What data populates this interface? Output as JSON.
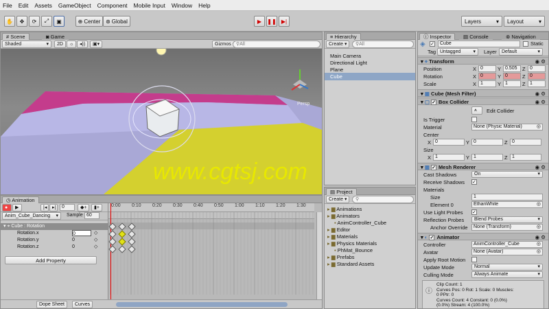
{
  "menu": [
    "File",
    "Edit",
    "Assets",
    "GameObject",
    "Component",
    "Mobile Input",
    "Window",
    "Help"
  ],
  "toolbar": {
    "pivot": "Center",
    "space": "Global",
    "layers": "Layers",
    "layout": "Layout"
  },
  "scene": {
    "tab_scene": "Scene",
    "tab_game": "Game",
    "shading": "Shaded",
    "mode_2d": "2D",
    "gizmos": "Gizmos",
    "search_placeholder": "All",
    "persp": "Persp",
    "watermark": "www.cgtsj.com",
    "colors": {
      "magenta": "#c43c8c",
      "yellow": "#d6d226",
      "lavender": "#b8b7e6",
      "watermark": "#e8e800"
    }
  },
  "hierarchy": {
    "tab": "Hierarchy",
    "create": "Create",
    "search_placeholder": "All",
    "items": [
      "Main Camera",
      "Directional Light",
      "Plane",
      "Cube"
    ],
    "selected": "Cube"
  },
  "project": {
    "tab": "Project",
    "create": "Create",
    "items": [
      {
        "label": "Animations",
        "level": 0
      },
      {
        "label": "Animators",
        "level": 0
      },
      {
        "label": "AnimController_Cube",
        "level": 1
      },
      {
        "label": "Editor",
        "level": 0
      },
      {
        "label": "Materials",
        "level": 0
      },
      {
        "label": "Physics Materials",
        "level": 0
      },
      {
        "label": "PhMat_Bounce",
        "level": 1
      },
      {
        "label": "Prefabs",
        "level": 0
      },
      {
        "label": "Standard Assets",
        "level": 0
      }
    ]
  },
  "animation": {
    "tab": "Animation",
    "frame": "0",
    "clip": "Anim_Cube_Dancing",
    "sample_label": "Sample",
    "sample": "60",
    "root": "Cube : Rotation",
    "props": [
      "Rotation.x",
      "Rotation.y",
      "Rotation.z"
    ],
    "values": [
      "0",
      "0",
      "0"
    ],
    "add_property": "Add Property",
    "ticks": [
      "0:00",
      "0:10",
      "0:20",
      "0:30",
      "0:40",
      "0:50",
      "1:00",
      "1:10",
      "1:20",
      "1:30"
    ],
    "dope_sheet": "Dope Sheet",
    "curves": "Curves"
  },
  "inspector": {
    "tab": "Inspector",
    "tab_console": "Console",
    "tab_nav": "Navigation",
    "name": "Cube",
    "static": "Static",
    "tag_label": "Tag",
    "tag": "Untagged",
    "layer_label": "Layer",
    "layer": "Default",
    "transform": "Transform",
    "position": {
      "label": "Position",
      "x": "0",
      "y": "0.505",
      "z": "0"
    },
    "rotation": {
      "label": "Rotation",
      "x": "0",
      "y": "0",
      "z": "0"
    },
    "scale": {
      "label": "Scale",
      "x": "1",
      "y": "1",
      "z": "1"
    },
    "mesh_filter": "Cube (Mesh Filter)",
    "box_collider": "Box Collider",
    "edit_collider": "Edit Collider",
    "is_trigger": "Is Trigger",
    "material_label": "Material",
    "material": "None (Physic Material)",
    "center": {
      "label": "Center",
      "x": "0",
      "y": "0",
      "z": "0"
    },
    "size": {
      "label": "Size",
      "x": "1",
      "y": "1",
      "z": "1"
    },
    "mesh_renderer": "Mesh Renderer",
    "cast_shadows_label": "Cast Shadows",
    "cast_shadows": "On",
    "receive_shadows": "Receive Shadows",
    "materials_label": "Materials",
    "mat_size_label": "Size",
    "mat_size": "1",
    "element0_label": "Element 0",
    "element0": "EthanWhite",
    "use_light_probes": "Use Light Probes",
    "reflection_probes_label": "Reflection Probes",
    "reflection_probes": "Blend Probes",
    "anchor_override_label": "Anchor Override",
    "anchor_override": "None (Transform)",
    "animator": "Animator",
    "controller_label": "Controller",
    "controller": "AnimController_Cube",
    "avatar_label": "Avatar",
    "avatar": "None (Avatar)",
    "apply_root_motion": "Apply Root Motion",
    "update_mode_label": "Update Mode",
    "update_mode": "Normal",
    "culling_mode_label": "Culling Mode",
    "culling_mode": "Always Animate",
    "info": [
      "Clip Count: 1",
      "Curves Pos: 0 Rot: 1 Scale: 0 Muscles:",
      "0 PPtr: 0",
      "Curves Count: 4 Constant: 0 (0.0%)",
      "(0.0%) Stream: 4 (100.0%)"
    ]
  }
}
